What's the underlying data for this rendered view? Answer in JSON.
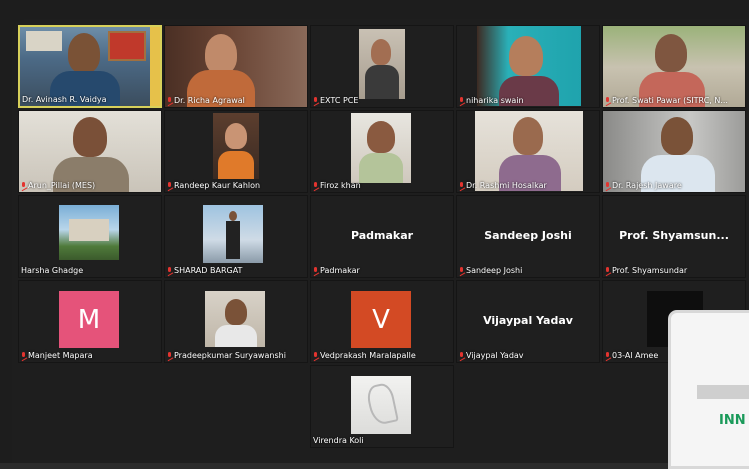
{
  "participants": [
    {
      "name": "Dr. Avinash R. Vaidya",
      "muted": false,
      "active": true
    },
    {
      "name": "Dr. Richa Agrawal",
      "muted": true
    },
    {
      "name": "EXTC PCE",
      "muted": true
    },
    {
      "name": "niharika swain",
      "muted": true
    },
    {
      "name": "Prof. Swati Pawar (SITRC, N...",
      "muted": true
    },
    {
      "name": "Arun_Pillai (MES)",
      "muted": true
    },
    {
      "name": "Randeep Kaur Kahlon",
      "muted": true
    },
    {
      "name": "Firoz khan",
      "muted": true
    },
    {
      "name": "Dr. Rashmi Hosalkar",
      "muted": true
    },
    {
      "name": "Dr. Rajesh Jaware",
      "muted": true
    },
    {
      "name": "Harsha Ghadge",
      "muted": false
    },
    {
      "name": "SHARAD BARGAT",
      "muted": true
    },
    {
      "name": "Padmakar",
      "muted": true,
      "display_name": "Padmakar"
    },
    {
      "name": "Sandeep Joshi",
      "muted": true,
      "display_name": "Sandeep Joshi"
    },
    {
      "name": "Prof. Shyamsundar",
      "muted": true,
      "display_name": "Prof.  Shyamsun..."
    },
    {
      "name": "Manjeet Mapara",
      "muted": true,
      "avatar_letter": "M",
      "avatar_color": "#e5537a"
    },
    {
      "name": "Pradeepkumar Suryawanshi",
      "muted": true
    },
    {
      "name": "Vedprakash Maralapalle",
      "muted": true,
      "avatar_letter": "V",
      "avatar_color": "#d34a24"
    },
    {
      "name": "Vijaypal Yadav",
      "muted": true,
      "display_name": "Vijaypal Yadav"
    },
    {
      "name": "03-Al Amee",
      "muted": true
    },
    {
      "name": "Virendra Koli",
      "muted": false
    }
  ],
  "overlay_text": "INN"
}
